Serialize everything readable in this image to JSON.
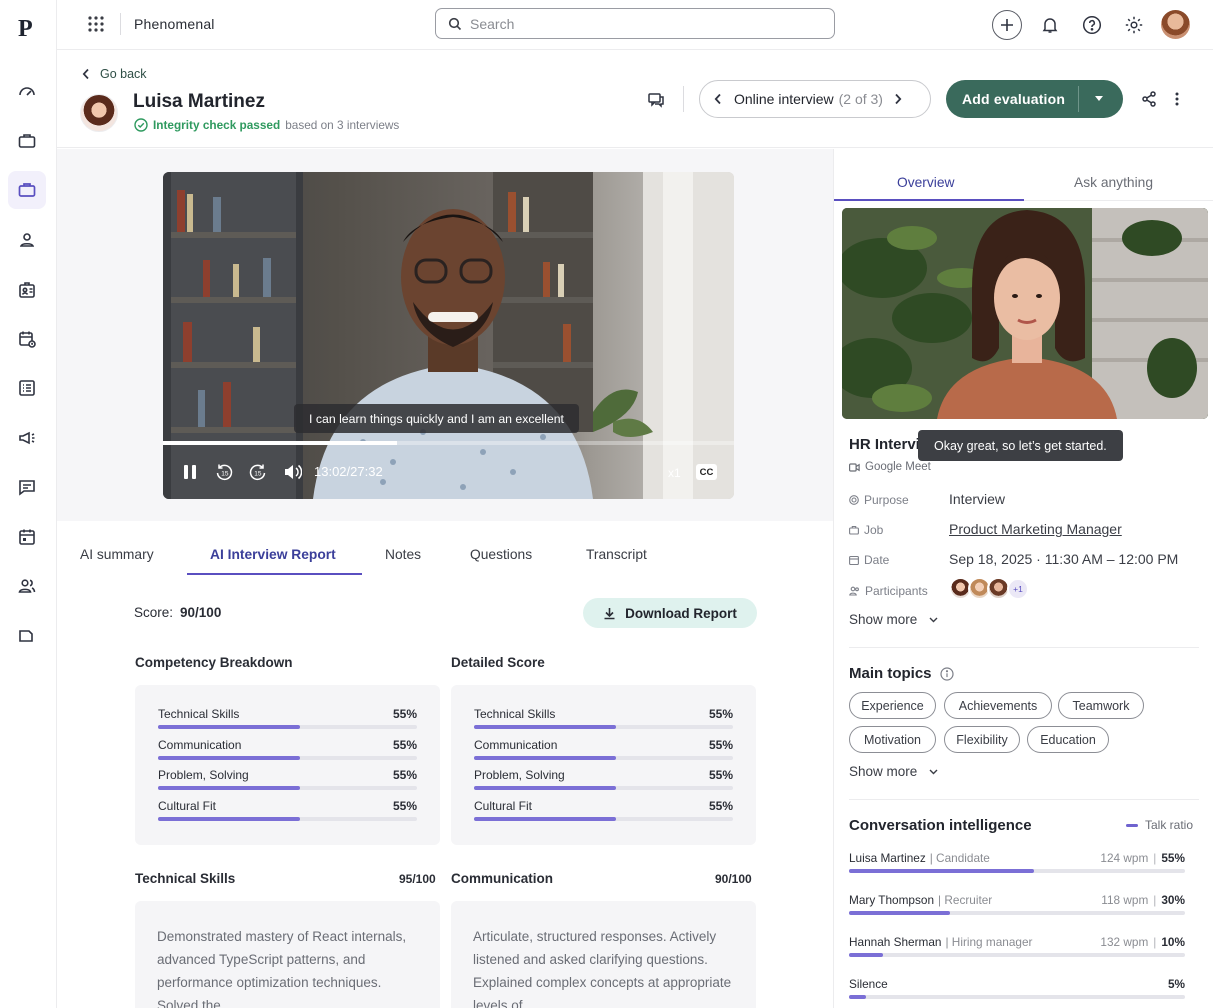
{
  "app": {
    "title": "Phenomenal"
  },
  "search": {
    "placeholder": "Search"
  },
  "header": {
    "back_label": "Go back",
    "candidate_name": "Luisa Martinez",
    "integrity_label": "Integrity check passed",
    "integrity_suffix": "based on 3 interviews",
    "interview_nav_label": "Online interview",
    "interview_nav_count": "(2 of 3)",
    "add_evaluation_label": "Add evaluation"
  },
  "video": {
    "caption": "I can learn things quickly and I am an excellent",
    "time": "13:02/27:32",
    "speed": "x1",
    "cc": "CC",
    "progress": 0.41
  },
  "tabs": [
    {
      "label": "AI summary"
    },
    {
      "label": "AI Interview Report"
    },
    {
      "label": "Notes"
    },
    {
      "label": "Questions"
    },
    {
      "label": "Transcript"
    }
  ],
  "report": {
    "score_label": "Score:",
    "score_value": "90/100",
    "download_label": "Download Report",
    "competency": {
      "title": "Competency Breakdown",
      "rows": [
        {
          "label": "Technical Skills",
          "value": "55%",
          "fill": 0.55
        },
        {
          "label": "Communication",
          "value": "55%",
          "fill": 0.55
        },
        {
          "label": "Problem, Solving",
          "value": "55%",
          "fill": 0.55
        },
        {
          "label": "Cultural Fit",
          "value": "55%",
          "fill": 0.55
        }
      ]
    },
    "detailed": {
      "title": "Detailed Score",
      "rows": [
        {
          "label": "Technical Skills",
          "value": "55%",
          "fill": 0.55
        },
        {
          "label": "Communication",
          "value": "55%",
          "fill": 0.55
        },
        {
          "label": "Problem, Solving",
          "value": "55%",
          "fill": 0.55
        },
        {
          "label": "Cultural Fit",
          "value": "55%",
          "fill": 0.55
        }
      ]
    },
    "technical": {
      "title": "Technical Skills",
      "score": "95/100",
      "text": "Demonstrated mastery of React internals, advanced TypeScript patterns, and performance optimization techniques. Solved the"
    },
    "communication": {
      "title": "Communication",
      "score": "90/100",
      "text": "Articulate, structured responses. Actively listened and asked clarifying questions. Explained complex concepts at appropriate levels of"
    }
  },
  "panel": {
    "tabs": [
      {
        "label": "Overview"
      },
      {
        "label": "Ask anything"
      }
    ],
    "tooltip": "Okay great, so let’s get started.",
    "meeting_title": "HR Interview",
    "meeting_platform": "Google Meet",
    "details": [
      {
        "key": "Purpose",
        "value": "Interview"
      },
      {
        "key": "Job",
        "value": "Product Marketing Manager"
      },
      {
        "key": "Date",
        "value": "Sep 18, 2025 · 11:30 AM – 12:00 PM"
      },
      {
        "key": "Participants",
        "value": "+1"
      }
    ],
    "show_more": "Show more",
    "topics_title": "Main topics",
    "topics": [
      "Experience",
      "Achievements",
      "Teamwork",
      "Motivation",
      "Flexibility",
      "Education"
    ],
    "ci_title": "Conversation intelligence",
    "ci_legend": "Talk ratio",
    "speakers": [
      {
        "name": "Luisa Martinez",
        "role": "Candidate",
        "wpm": "124 wpm",
        "pct": "55%",
        "ratio": 0.55
      },
      {
        "name": "Mary Thompson",
        "role": "Recruiter",
        "wpm": "118 wpm",
        "pct": "30%",
        "ratio": 0.3
      },
      {
        "name": "Hannah Sherman",
        "role": "Hiring manager",
        "wpm": "132 wpm",
        "pct": "10%",
        "ratio": 0.1
      },
      {
        "name": "Silence",
        "role": "",
        "wpm": "",
        "pct": "5%",
        "ratio": 0.05
      }
    ]
  },
  "colors": {
    "accent": "#3a6a5c",
    "purple": "#6f63cf",
    "integrity": "#2f9a5f",
    "download_bg": "#dff2ee"
  }
}
